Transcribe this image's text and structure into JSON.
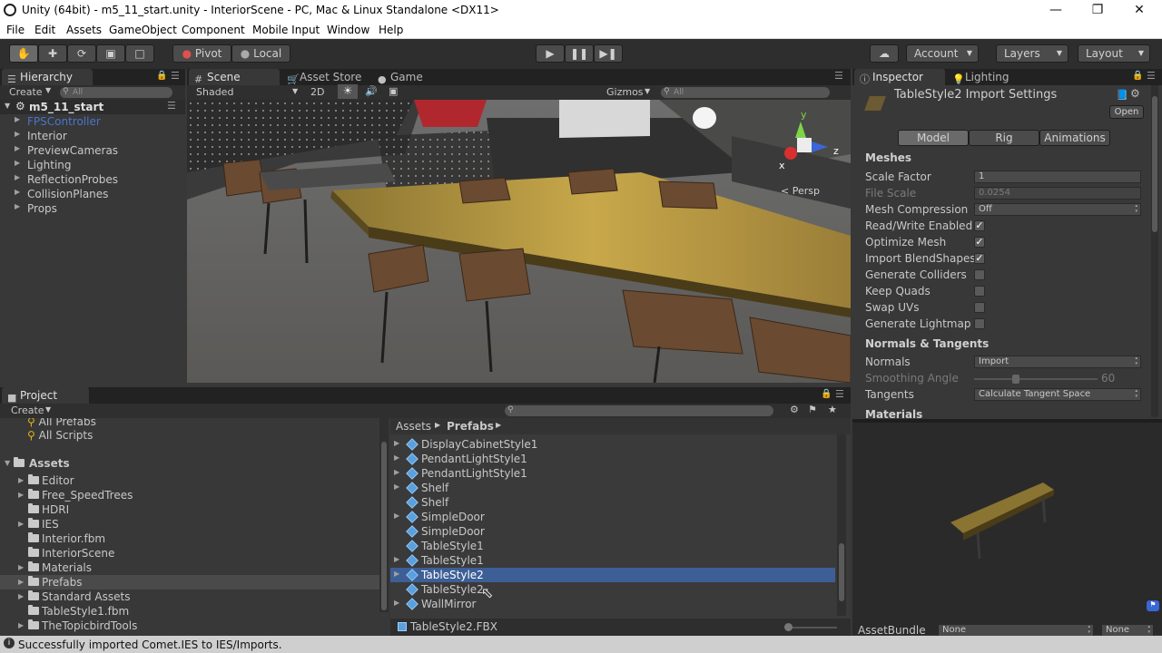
{
  "window": {
    "title": "Unity (64bit) - m5_11_start.unity - InteriorScene - PC, Mac & Linux Standalone <DX11>",
    "minimize": "—",
    "maximize": "❐",
    "close": "✕"
  },
  "menu": [
    "File",
    "Edit",
    "Assets",
    "GameObject",
    "Component",
    "Mobile Input",
    "Window",
    "Help"
  ],
  "toolbar": {
    "pivot": "Pivot",
    "local": "Local",
    "account": "Account",
    "layers": "Layers",
    "layout": "Layout"
  },
  "hierarchy": {
    "tab": "Hierarchy",
    "create": "Create",
    "search_placeholder": "All",
    "scene_name": "m5_11_start",
    "items": [
      "FPSController",
      "Interior",
      "PreviewCameras",
      "Lighting",
      "ReflectionProbes",
      "CollisionPlanes",
      "Props"
    ]
  },
  "scene": {
    "tabs": [
      "Scene",
      "Asset Store",
      "Game"
    ],
    "shading": "Shaded",
    "mode_2d": "2D",
    "gizmos": "Gizmos",
    "search_placeholder": "All",
    "persp": "Persp",
    "axis_y": "y",
    "axis_x": "x",
    "axis_z": "z"
  },
  "inspector": {
    "tabs": [
      "Inspector",
      "Lighting"
    ],
    "title": "TableStyle2 Import Settings",
    "open": "Open",
    "modes": [
      "Model",
      "Rig",
      "Animations"
    ],
    "meshes_header": "Meshes",
    "scale_factor_label": "Scale Factor",
    "scale_factor": "1",
    "file_scale_label": "File Scale",
    "file_scale": "0.0254",
    "mesh_compression_label": "Mesh Compression",
    "mesh_compression": "Off",
    "checks": [
      {
        "label": "Read/Write Enabled",
        "checked": true
      },
      {
        "label": "Optimize Mesh",
        "checked": true
      },
      {
        "label": "Import BlendShapes",
        "checked": true
      },
      {
        "label": "Generate Colliders",
        "checked": false
      },
      {
        "label": "Keep Quads",
        "checked": false
      },
      {
        "label": "Swap UVs",
        "checked": false
      },
      {
        "label": "Generate Lightmap U",
        "checked": false
      }
    ],
    "normals_header": "Normals & Tangents",
    "normals_label": "Normals",
    "normals": "Import",
    "smoothing_label": "Smoothing Angle",
    "smoothing": "60",
    "tangents_label": "Tangents",
    "tangents": "Calculate Tangent Space",
    "materials_header": "Materials",
    "assetbundle_label": "AssetBundle",
    "assetbundle": "None",
    "assetbundle_variant": "None"
  },
  "project": {
    "tab": "Project",
    "create": "Create",
    "favorites": [
      "All Prefabs",
      "All Scripts"
    ],
    "assets_header": "Assets",
    "folders": [
      {
        "name": "Editor",
        "arrow": true,
        "folder": true
      },
      {
        "name": "Free_SpeedTrees",
        "arrow": true,
        "folder": true
      },
      {
        "name": "HDRI",
        "arrow": false,
        "folder": true
      },
      {
        "name": "IES",
        "arrow": true,
        "folder": true
      },
      {
        "name": "Interior.fbm",
        "arrow": false,
        "folder": true
      },
      {
        "name": "InteriorScene",
        "arrow": false,
        "folder": true
      },
      {
        "name": "Materials",
        "arrow": true,
        "folder": true
      },
      {
        "name": "Prefabs",
        "arrow": true,
        "folder": true,
        "selected": true
      },
      {
        "name": "Standard Assets",
        "arrow": true,
        "folder": true
      },
      {
        "name": "TableStyle1.fbm",
        "arrow": false,
        "folder": true
      },
      {
        "name": "TheTopicbirdTools",
        "arrow": true,
        "folder": true
      }
    ],
    "breadcrumb": [
      "Assets",
      "Prefabs"
    ],
    "assets": [
      {
        "name": "DisplayCabinetStyle1",
        "arrow": true
      },
      {
        "name": "PendantLightStyle1",
        "arrow": true
      },
      {
        "name": "PendantLightStyle1",
        "arrow": true
      },
      {
        "name": "Shelf",
        "arrow": true
      },
      {
        "name": "Shelf",
        "arrow": false
      },
      {
        "name": "SimpleDoor",
        "arrow": true
      },
      {
        "name": "SimpleDoor",
        "arrow": false
      },
      {
        "name": "TableStyle1",
        "arrow": false
      },
      {
        "name": "TableStyle1",
        "arrow": true
      },
      {
        "name": "TableStyle2",
        "arrow": true,
        "selected": true
      },
      {
        "name": "TableStyle2",
        "arrow": false
      },
      {
        "name": "WallMirror",
        "arrow": true
      }
    ],
    "footer_file": "TableStyle2.FBX"
  },
  "status": {
    "message": "Successfully imported Comet.IES to IES/Imports."
  }
}
